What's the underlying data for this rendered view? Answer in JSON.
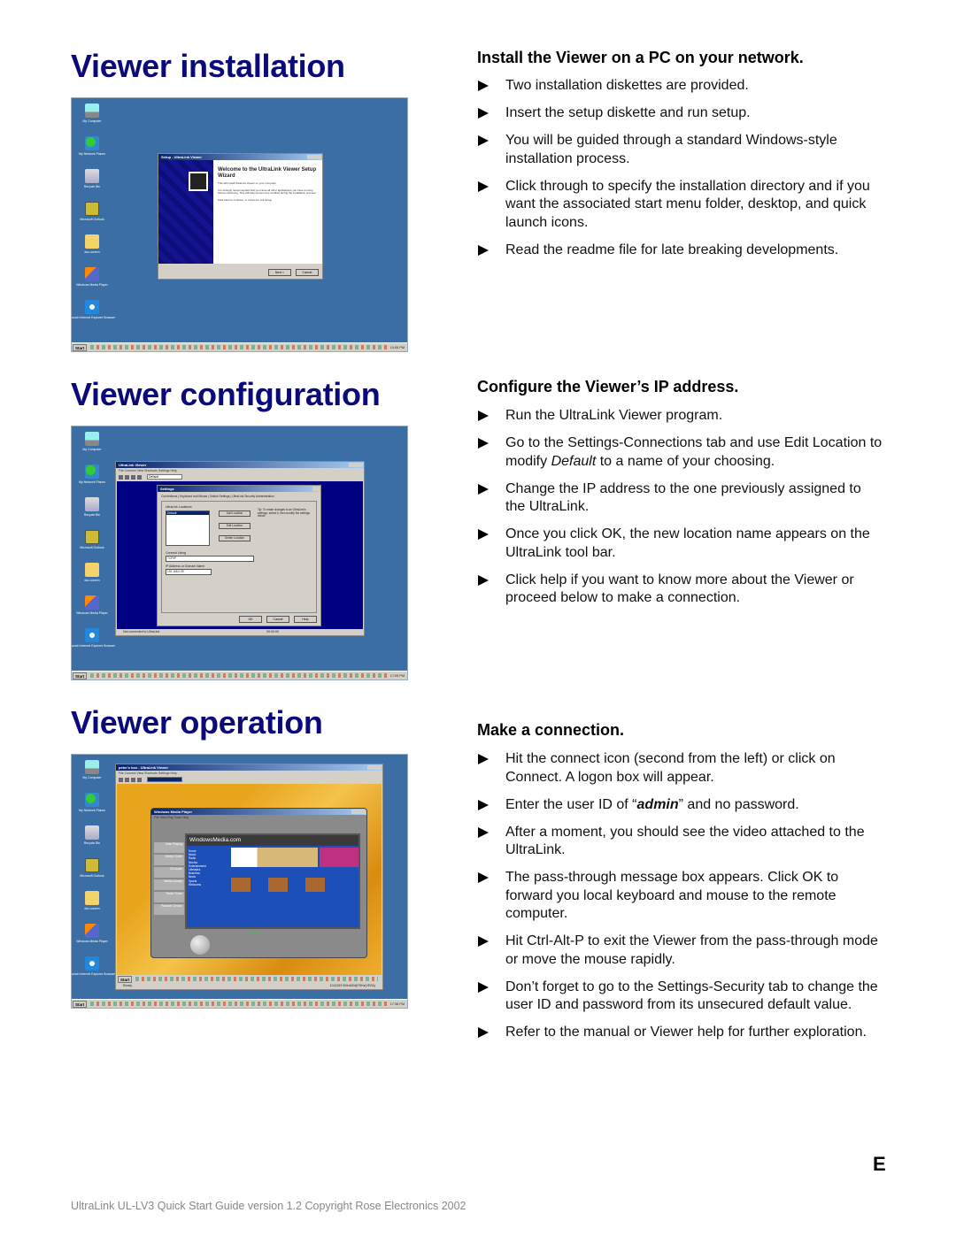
{
  "sections": [
    {
      "title": "Viewer installation",
      "subheading": "Install the Viewer on a PC on your network.",
      "bullets": [
        "Two installation diskettes are provided.",
        "Insert the setup diskette and run setup.",
        "You will be guided through a standard Windows-style installation process.",
        "Click through to specify the installation directory and if you want the associated start menu folder, desktop, and quick launch icons.",
        "Read the readme file for late breaking developments."
      ]
    },
    {
      "title": "Viewer configuration",
      "subheading": "Configure the Viewer’s IP address.",
      "bullets": [
        "Run the UltraLink Viewer program.",
        {
          "pre": "Go to the Settings-Connections tab and use Edit Location to modify ",
          "em": "Default",
          "post": " to a name of your choosing."
        },
        "Change the IP address to the one previously assigned to the UltraLink.",
        "Once you click OK, the new location name appears on the UltraLink tool bar.",
        "Click help if you want to know more about the Viewer or proceed below to make a connection."
      ]
    },
    {
      "title": "Viewer operation",
      "subheading": "Make a connection.",
      "bullets": [
        "Hit the connect icon (second from the left) or click on Connect.  A logon box will appear.",
        {
          "pre": "Enter the user ID of “",
          "strong": "admin",
          "post": "” and no password."
        },
        "After a moment, you should see the video attached to the UltraLink.",
        "The pass-through message box appears.  Click OK to forward you local keyboard and mouse to the remote computer.",
        "Hit Ctrl-Alt-P to exit the Viewer from the pass-through mode or move the mouse rapidly.",
        "Don’t forget to go to the Settings-Security tab to change the user ID and password from its unsecured default value.",
        "Refer to the manual or Viewer help for further exploration."
      ]
    }
  ],
  "desktop": {
    "icons": [
      "My Computer",
      "My Network Places",
      "Recycle Bin",
      "Microsoft Outlook",
      "doc-screen",
      "Windows Media Player",
      "Launch Internet Explorer Browser"
    ],
    "start_label": "Start",
    "clocks": [
      "10:55 PM",
      "17:05 PM",
      "17:38 PM"
    ],
    "colors": {
      "desktop": "#3a6ea5",
      "title_color": "#0a0a7a"
    }
  },
  "screenshot_install": {
    "window_title": "Setup - UltraLink Viewer",
    "heading": "Welcome to the UltraLink Viewer Setup Wizard",
    "text1": "This will install UltraLink Viewer on your computer.",
    "text2": "It is strongly recommended that you close all other applications you have running before continuing. This will help prevent any conflicts during the installation process.",
    "text3": "Click Next to continue, or Cancel to exit Setup.",
    "next": "Next >",
    "cancel": "Cancel"
  },
  "screenshot_config": {
    "window_title": "UltraLink Viewer",
    "menu": "File  Connect  View  Shortcuts  Settings  Help",
    "location": "Default",
    "status": "Not connected to UltraLink",
    "timer": "00:00:00",
    "dialog_title": "Settings",
    "tabs": "Connections | Keyboard and Mouse | Switch Settings | UltraLink Security Administration",
    "locations_label": "UltraLink Locations",
    "location_item": "Default",
    "add": "Add Location",
    "edit": "Edit Location",
    "delete": "Delete Location",
    "tip": "Tip: To make changes to an UltraLink's settings, select it, then modify the settings below.",
    "connect_using_label": "Connect Using",
    "connect_using": "TCP/IP",
    "ip_label": "IP Address or Domain Name",
    "ip": "192.168.0.99",
    "ok": "OK",
    "cancel": "Cancel",
    "help": "Help"
  },
  "screenshot_operation": {
    "window_title": "peter's box - UltraLink Viewer",
    "menu": "File  Connect  View  Shortcuts  Settings  Help",
    "player_title": "Windows Media Player",
    "player_menu": "File  View  Play  Tools  Help",
    "brand": "WindowsMedia.com",
    "nav": [
      "Home",
      "Music",
      "Radio",
      "Movies",
      "Entertainment",
      "Lifestyles",
      "Business",
      "News",
      "Sports",
      "Webcams"
    ],
    "side_buttons": [
      "Now Playing",
      "Media Guide",
      "CD Audio",
      "Media Library",
      "Radio Tuner",
      "Portable Device"
    ],
    "ready": "Ready",
    "status": "Ready",
    "status_right": "1013153 900x600@75Hz(VESA)"
  },
  "page_letter": "E",
  "footer": "UltraLink UL-LV3 Quick Start Guide version 1.2 Copyright Rose Electronics 2002"
}
